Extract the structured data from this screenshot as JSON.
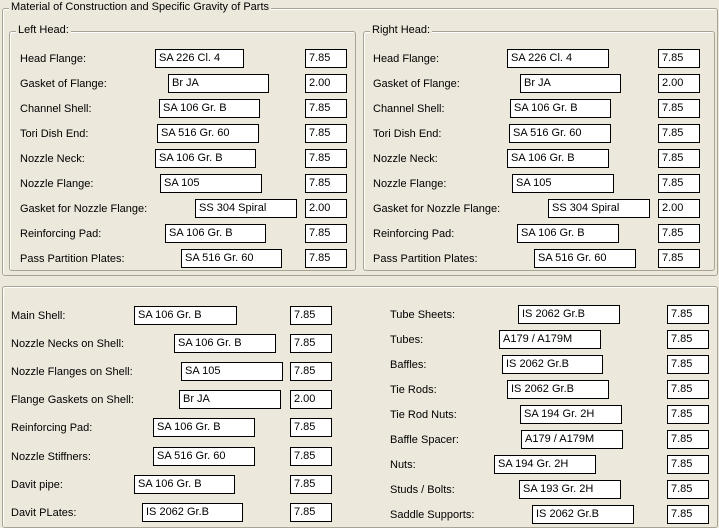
{
  "top_group": {
    "title": "Material of Construction and Specific Gravity of Parts"
  },
  "left_head": {
    "title": "Left Head:",
    "rows": [
      {
        "label": "Head Flange:",
        "material": "SA 226 Cl. 4",
        "sg": "7.85"
      },
      {
        "label": "Gasket of Flange:",
        "material": "Br JA",
        "sg": "2.00"
      },
      {
        "label": "Channel Shell:",
        "material": "SA 106 Gr. B",
        "sg": "7.85"
      },
      {
        "label": "Tori Dish End:",
        "material": "SA 516 Gr. 60",
        "sg": "7.85"
      },
      {
        "label": "Nozzle Neck:",
        "material": "SA 106 Gr. B",
        "sg": "7.85"
      },
      {
        "label": "Nozzle Flange:",
        "material": "SA 105",
        "sg": "7.85"
      },
      {
        "label": "Gasket for Nozzle Flange:",
        "material": "SS 304 Spiral",
        "sg": "2.00"
      },
      {
        "label": "Reinforcing Pad:",
        "material": "SA 106 Gr. B",
        "sg": "7.85"
      },
      {
        "label": "Pass Partition Plates:",
        "material": "SA 516 Gr. 60",
        "sg": "7.85"
      }
    ]
  },
  "right_head": {
    "title": "Right Head:",
    "rows": [
      {
        "label": "Head Flange:",
        "material": "SA 226 Cl. 4",
        "sg": "7.85"
      },
      {
        "label": "Gasket of Flange:",
        "material": "Br JA",
        "sg": "2.00"
      },
      {
        "label": "Channel Shell:",
        "material": "SA 106 Gr. B",
        "sg": "7.85"
      },
      {
        "label": "Tori Dish End:",
        "material": "SA 516 Gr. 60",
        "sg": "7.85"
      },
      {
        "label": "Nozzle Neck:",
        "material": "SA 106 Gr. B",
        "sg": "7.85"
      },
      {
        "label": "Nozzle Flange:",
        "material": "SA 105",
        "sg": "7.85"
      },
      {
        "label": "Gasket for Nozzle Flange:",
        "material": "SS 304 Spiral",
        "sg": "2.00"
      },
      {
        "label": "Reinforcing Pad:",
        "material": "SA 106 Gr. B",
        "sg": "7.85"
      },
      {
        "label": "Pass Partition Plates:",
        "material": "SA 516 Gr. 60",
        "sg": "7.85"
      }
    ]
  },
  "shell": {
    "rows": [
      {
        "label": "Main Shell:",
        "material": "SA 106 Gr. B",
        "sg": "7.85"
      },
      {
        "label": "Nozzle Necks on Shell:",
        "material": "SA 106 Gr. B",
        "sg": "7.85"
      },
      {
        "label": "Nozzle Flanges on Shell:",
        "material": "SA 105",
        "sg": "7.85"
      },
      {
        "label": "Flange Gaskets on Shell:",
        "material": "Br JA",
        "sg": "2.00"
      },
      {
        "label": "Reinforcing Pad:",
        "material": "SA 106 Gr. B",
        "sg": "7.85"
      },
      {
        "label": "Nozzle Stiffners:",
        "material": "SA 516 Gr. 60",
        "sg": "7.85"
      },
      {
        "label": "Davit pipe:",
        "material": "SA 106 Gr. B",
        "sg": "7.85"
      },
      {
        "label": "Davit PLates:",
        "material": "IS 2062 Gr.B",
        "sg": "7.85"
      }
    ]
  },
  "tubes": {
    "rows": [
      {
        "label": "Tube Sheets:",
        "material": "IS 2062 Gr.B",
        "sg": "7.85"
      },
      {
        "label": "Tubes:",
        "material": "A179 / A179M",
        "sg": "7.85"
      },
      {
        "label": "Baffles:",
        "material": "IS 2062 Gr.B",
        "sg": "7.85"
      },
      {
        "label": "Tie Rods:",
        "material": "IS 2062 Gr.B",
        "sg": "7.85"
      },
      {
        "label": "Tie Rod Nuts:",
        "material": "SA 194 Gr. 2H",
        "sg": "7.85"
      },
      {
        "label": "Baffle Spacer:",
        "material": "A179 / A179M",
        "sg": "7.85"
      },
      {
        "label": "Nuts:",
        "material": "SA 194 Gr. 2H",
        "sg": "7.85"
      },
      {
        "label": "Studs / Bolts:",
        "material": "SA 193 Gr. 2H",
        "sg": "7.85"
      },
      {
        "label": "Saddle Supports:",
        "material": "IS 2062 Gr.B",
        "sg": "7.85"
      }
    ]
  }
}
